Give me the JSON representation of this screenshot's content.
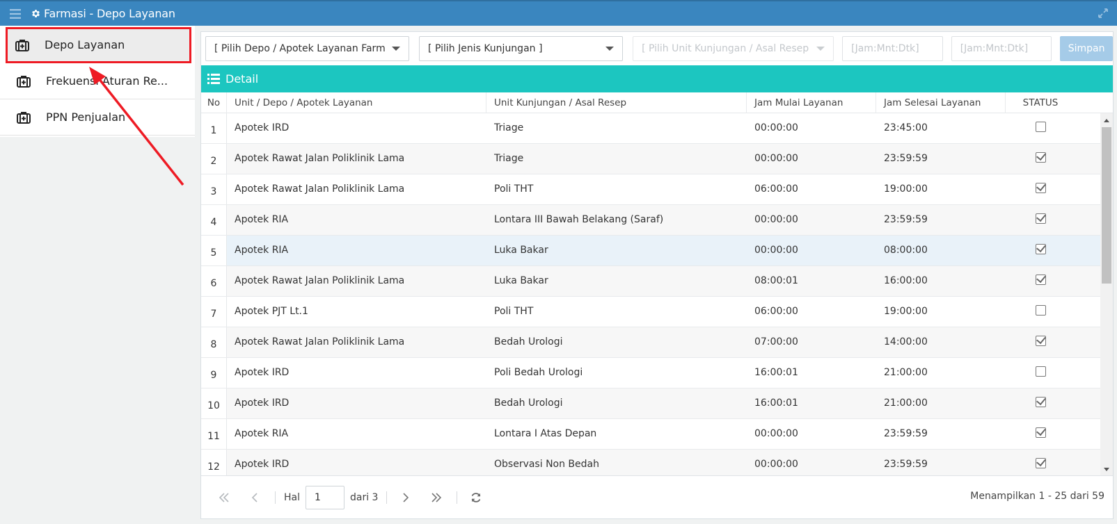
{
  "app": {
    "title": "Farmasi - Depo Layanan"
  },
  "sidebar": {
    "items": [
      {
        "label": "Depo Layanan",
        "icon": "medkit-icon",
        "active": true
      },
      {
        "label": "Frekuensi Aturan Re...",
        "icon": "medkit-icon",
        "active": false
      },
      {
        "label": "PPN Penjualan",
        "icon": "medkit-icon",
        "active": false
      }
    ]
  },
  "filters": {
    "depo": "[ Pilih Depo / Apotek Layanan Farmasi ]",
    "jenis_kunjungan": "[ Pilih Jenis Kunjungan ]",
    "unit_kunjungan": "[ Pilih Unit Kunjungan / Asal Resep ]",
    "jam_mulai_placeholder": "[Jam:Mnt:Dtk]",
    "jam_selesai_placeholder": "[Jam:Mnt:Dtk]",
    "save_label": "Simpan"
  },
  "detail": {
    "title": "Detail"
  },
  "table": {
    "headers": {
      "no": "No",
      "unit": "Unit / Depo / Apotek Layanan",
      "kunjungan": "Unit Kunjungan / Asal Resep",
      "mulai": "Jam Mulai Layanan",
      "selesai": "Jam Selesai Layanan",
      "status": "STATUS"
    },
    "rows": [
      {
        "no": "1",
        "unit": "Apotek IRD",
        "kunjungan": "Triage",
        "mulai": "00:00:00",
        "selesai": "23:45:00",
        "status": false
      },
      {
        "no": "2",
        "unit": "Apotek Rawat Jalan Poliklinik Lama",
        "kunjungan": "Triage",
        "mulai": "00:00:00",
        "selesai": "23:59:59",
        "status": true
      },
      {
        "no": "3",
        "unit": "Apotek Rawat Jalan Poliklinik Lama",
        "kunjungan": "Poli THT",
        "mulai": "06:00:00",
        "selesai": "19:00:00",
        "status": true
      },
      {
        "no": "4",
        "unit": "Apotek RIA",
        "kunjungan": "Lontara III Bawah Belakang (Saraf)",
        "mulai": "00:00:00",
        "selesai": "23:59:59",
        "status": true
      },
      {
        "no": "5",
        "unit": "Apotek RIA",
        "kunjungan": "Luka Bakar",
        "mulai": "00:00:00",
        "selesai": "08:00:00",
        "status": true
      },
      {
        "no": "6",
        "unit": "Apotek Rawat Jalan Poliklinik Lama",
        "kunjungan": "Luka Bakar",
        "mulai": "08:00:01",
        "selesai": "16:00:00",
        "status": true
      },
      {
        "no": "7",
        "unit": "Apotek PJT Lt.1",
        "kunjungan": "Poli THT",
        "mulai": "06:00:00",
        "selesai": "19:00:00",
        "status": false
      },
      {
        "no": "8",
        "unit": "Apotek Rawat Jalan Poliklinik Lama",
        "kunjungan": "Bedah Urologi",
        "mulai": "07:00:00",
        "selesai": "14:00:00",
        "status": true
      },
      {
        "no": "9",
        "unit": "Apotek IRD",
        "kunjungan": "Poli Bedah Urologi",
        "mulai": "16:00:01",
        "selesai": "21:00:00",
        "status": false
      },
      {
        "no": "10",
        "unit": "Apotek IRD",
        "kunjungan": "Bedah Urologi",
        "mulai": "16:00:01",
        "selesai": "21:00:00",
        "status": true
      },
      {
        "no": "11",
        "unit": "Apotek RIA",
        "kunjungan": "Lontara I Atas Depan",
        "mulai": "00:00:00",
        "selesai": "23:59:59",
        "status": true
      },
      {
        "no": "12",
        "unit": "Apotek IRD",
        "kunjungan": "Observasi Non Bedah",
        "mulai": "00:00:00",
        "selesai": "23:59:59",
        "status": true
      }
    ]
  },
  "pager": {
    "hal_label": "Hal",
    "current_page": "1",
    "of_label": "dari 3",
    "info": "Menampilkan 1 - 25 dari 59"
  },
  "colors": {
    "topbar": "#3a86bf",
    "detail_bar": "#1cc6c0",
    "highlight_outline": "#ee1b24",
    "save_button": "#a5cbe8"
  }
}
